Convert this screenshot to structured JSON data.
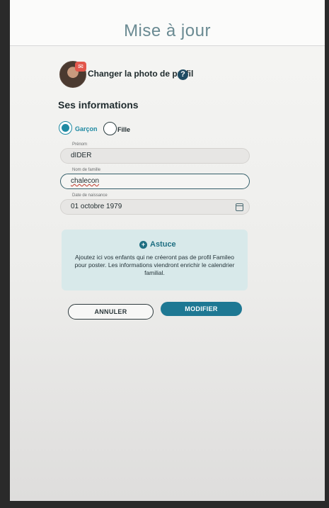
{
  "header": {
    "title": "Mise à jour"
  },
  "profile": {
    "change_photo_label": "Changer la photo de profil",
    "help_glyph": "?",
    "camera_badge_icon": "camera-icon"
  },
  "section": {
    "title": "Ses informations"
  },
  "gender": {
    "options": [
      {
        "label": "Garçon",
        "selected": true
      },
      {
        "label": "Fille",
        "selected": false
      }
    ]
  },
  "fields": {
    "first_name": {
      "label": "Prénom",
      "value": "dIDER"
    },
    "last_name": {
      "label": "Nom de famille",
      "value": "chalecon"
    },
    "birth_date": {
      "label": "Date de naissance",
      "value": "01 octobre 1979"
    }
  },
  "tip": {
    "title": "Astuce",
    "icon_glyph": "+",
    "text": "Ajoutez ici vos enfants qui ne créeront pas de profil Famileo pour poster. Les informations viendront enrichir le calendrier familial."
  },
  "buttons": {
    "cancel": "ANNULER",
    "modify": "MODIFIER"
  },
  "colors": {
    "accent": "#1e7893",
    "title": "#6a8a92",
    "tip_bg": "#d8e9ea"
  }
}
